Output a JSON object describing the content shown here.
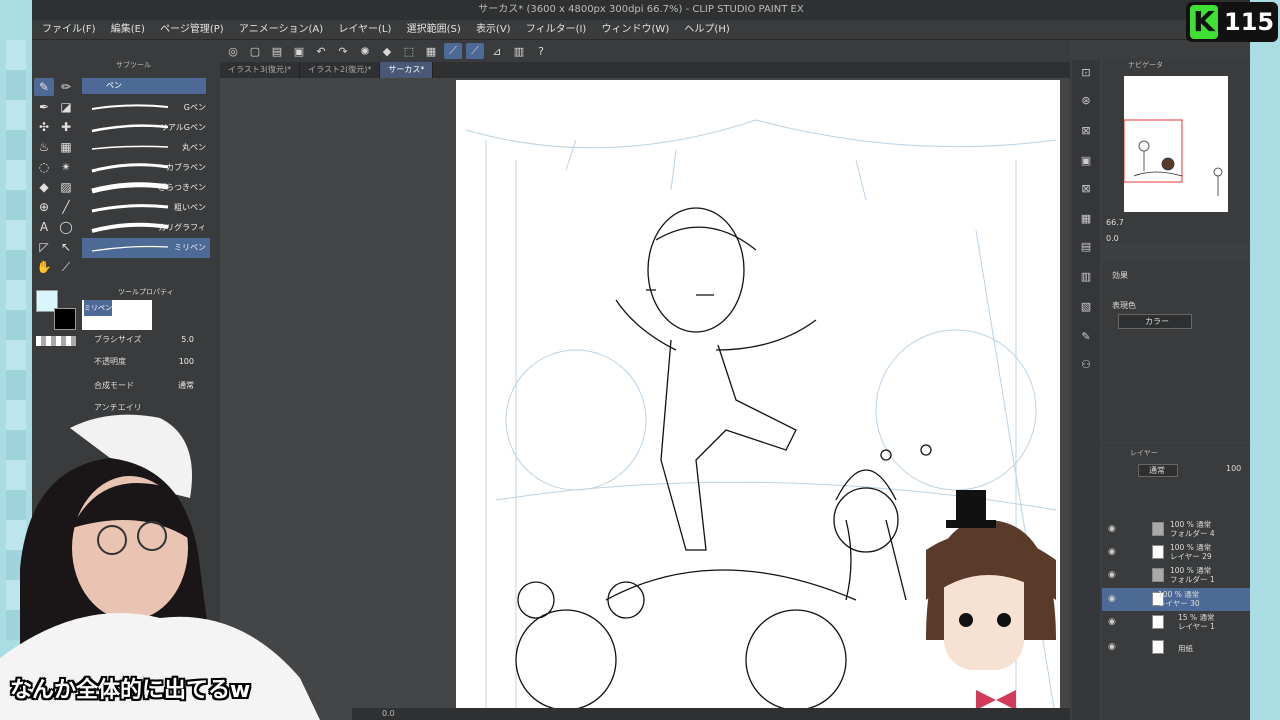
{
  "window": {
    "title": "サーカス* (3600 x 4800px 300dpi 66.7%) - CLIP STUDIO PAINT EX"
  },
  "menu": [
    "ファイル(F)",
    "編集(E)",
    "ページ管理(P)",
    "アニメーション(A)",
    "レイヤー(L)",
    "選択範囲(S)",
    "表示(V)",
    "フィルター(I)",
    "ウィンドウ(W)",
    "ヘルプ(H)"
  ],
  "tabs": [
    "イラスト3(復元)*",
    "イラスト2(復元)*",
    "サーカス*"
  ],
  "subtool": {
    "header": "サブツール",
    "group": "ペン",
    "brushes": [
      "Gペン",
      "リアルGペン",
      "丸ペン",
      "カブラペン",
      "ざらつきペン",
      "粗いペン",
      "カリグラフィ",
      "ミリペン"
    ],
    "selected_index": 7
  },
  "tool_property": {
    "header": "ツールプロパティ",
    "brush_name": "ミリペン",
    "size_label": "ブラシサイズ",
    "size_value": "5.0",
    "opacity_label": "不透明度",
    "opacity_value": "100",
    "blend_label": "合成モード",
    "blend_value": "通常",
    "aa_label": "アンチエイリ"
  },
  "navigator": {
    "header": "ナビゲータ",
    "zoom": "66.7",
    "rotate": "0.0"
  },
  "effect": {
    "header": "効果",
    "color_label": "表現色",
    "color_value": "カラー"
  },
  "layers": {
    "header": "レイヤー",
    "blend": "通常",
    "opacity": "100",
    "items": [
      {
        "line1": "100 % 通常",
        "line2": "フォルダー 4",
        "type": "folder"
      },
      {
        "line1": "100 % 通常",
        "line2": "レイヤー 29",
        "type": "layer"
      },
      {
        "line1": "100 % 通常",
        "line2": "フォルダー 1",
        "type": "folder"
      },
      {
        "line1": "100 % 通常",
        "line2": "レイヤー 30",
        "type": "layer",
        "selected": true
      },
      {
        "line1": "15 % 通常",
        "line2": "レイヤー 1",
        "type": "layer"
      },
      {
        "line1": "",
        "line2": "用紙",
        "type": "paper"
      }
    ]
  },
  "status": {
    "zoom": "0.0"
  },
  "overlay": {
    "subtitle": "なんか全体的に出てるw",
    "badge_letter": "K",
    "badge_number": "115"
  },
  "colors": {
    "accent": "#4d6a96",
    "main_color": "#d8f6fb",
    "sub_color": "#000000"
  }
}
